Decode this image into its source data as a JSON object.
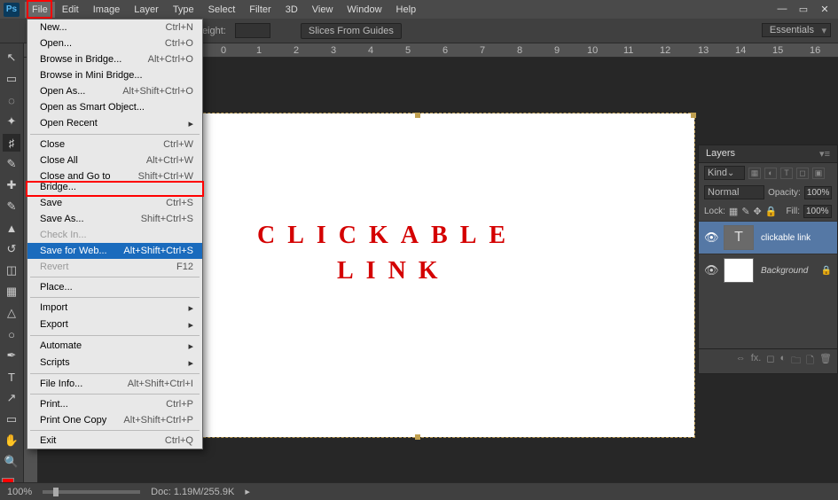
{
  "app": {
    "logo": "Ps"
  },
  "menubar": [
    "File",
    "Edit",
    "Image",
    "Layer",
    "Type",
    "Select",
    "Filter",
    "3D",
    "View",
    "Window",
    "Help"
  ],
  "optbar": {
    "height_label": "Height:",
    "slices_btn": "Slices From Guides",
    "workspace": "Essentials"
  },
  "ruler_h": [
    {
      "pos": 249,
      "v": "0"
    },
    {
      "pos": 289,
      "v": "1"
    },
    {
      "pos": 331,
      "v": "2"
    },
    {
      "pos": 373,
      "v": "3"
    },
    {
      "pos": 415,
      "v": "4"
    },
    {
      "pos": 457,
      "v": "5"
    },
    {
      "pos": 499,
      "v": "6"
    },
    {
      "pos": 541,
      "v": "7"
    },
    {
      "pos": 583,
      "v": "8"
    },
    {
      "pos": 625,
      "v": "9"
    },
    {
      "pos": 662,
      "v": "10"
    },
    {
      "pos": 703,
      "v": "11"
    },
    {
      "pos": 744,
      "v": "12"
    },
    {
      "pos": 787,
      "v": "13"
    },
    {
      "pos": 829,
      "v": "14"
    },
    {
      "pos": 871,
      "v": "15"
    },
    {
      "pos": 913,
      "v": "16"
    }
  ],
  "dropdown": [
    {
      "t": "item",
      "label": "New...",
      "sc": "Ctrl+N"
    },
    {
      "t": "item",
      "label": "Open...",
      "sc": "Ctrl+O"
    },
    {
      "t": "item",
      "label": "Browse in Bridge...",
      "sc": "Alt+Ctrl+O"
    },
    {
      "t": "item",
      "label": "Browse in Mini Bridge..."
    },
    {
      "t": "item",
      "label": "Open As...",
      "sc": "Alt+Shift+Ctrl+O"
    },
    {
      "t": "item",
      "label": "Open as Smart Object..."
    },
    {
      "t": "sub",
      "label": "Open Recent"
    },
    {
      "t": "sep"
    },
    {
      "t": "item",
      "label": "Close",
      "sc": "Ctrl+W"
    },
    {
      "t": "item",
      "label": "Close All",
      "sc": "Alt+Ctrl+W"
    },
    {
      "t": "item",
      "label": "Close and Go to Bridge...",
      "sc": "Shift+Ctrl+W"
    },
    {
      "t": "item",
      "label": "Save",
      "sc": "Ctrl+S"
    },
    {
      "t": "item",
      "label": "Save As...",
      "sc": "Shift+Ctrl+S"
    },
    {
      "t": "dis",
      "label": "Check In..."
    },
    {
      "t": "hl",
      "label": "Save for Web...",
      "sc": "Alt+Shift+Ctrl+S"
    },
    {
      "t": "dis",
      "label": "Revert",
      "sc": "F12"
    },
    {
      "t": "sep"
    },
    {
      "t": "item",
      "label": "Place..."
    },
    {
      "t": "sep"
    },
    {
      "t": "sub",
      "label": "Import"
    },
    {
      "t": "sub",
      "label": "Export"
    },
    {
      "t": "sep"
    },
    {
      "t": "sub",
      "label": "Automate"
    },
    {
      "t": "sub",
      "label": "Scripts"
    },
    {
      "t": "sep"
    },
    {
      "t": "item",
      "label": "File Info...",
      "sc": "Alt+Shift+Ctrl+I"
    },
    {
      "t": "sep"
    },
    {
      "t": "item",
      "label": "Print...",
      "sc": "Ctrl+P"
    },
    {
      "t": "item",
      "label": "Print One Copy",
      "sc": "Alt+Shift+Ctrl+P"
    },
    {
      "t": "sep"
    },
    {
      "t": "item",
      "label": "Exit",
      "sc": "Ctrl+Q"
    }
  ],
  "canvas_text": {
    "line1": "CLICKABLE",
    "line2": "LINK"
  },
  "layers": {
    "tab": "Layers",
    "kind": "Kind",
    "blend": "Normal",
    "opacity_label": "Opacity:",
    "opacity": "100%",
    "lock_label": "Lock:",
    "fill_label": "Fill:",
    "fill": "100%",
    "rows": [
      {
        "thumb": "T",
        "name": "clickable link",
        "sel": true,
        "italic": false,
        "lock": false
      },
      {
        "thumb": "",
        "name": "Background",
        "sel": false,
        "italic": true,
        "lock": true
      }
    ]
  },
  "status": {
    "zoom": "100%",
    "doc": "Doc: 1.19M/255.9K"
  },
  "tools": [
    "move",
    "marquee",
    "lasso",
    "wand",
    "crop",
    "eyedrop",
    "heal",
    "brush",
    "stamp",
    "history",
    "eraser",
    "grad",
    "blur",
    "dodge",
    "pen",
    "type",
    "path",
    "shape",
    "hand",
    "zoom"
  ]
}
